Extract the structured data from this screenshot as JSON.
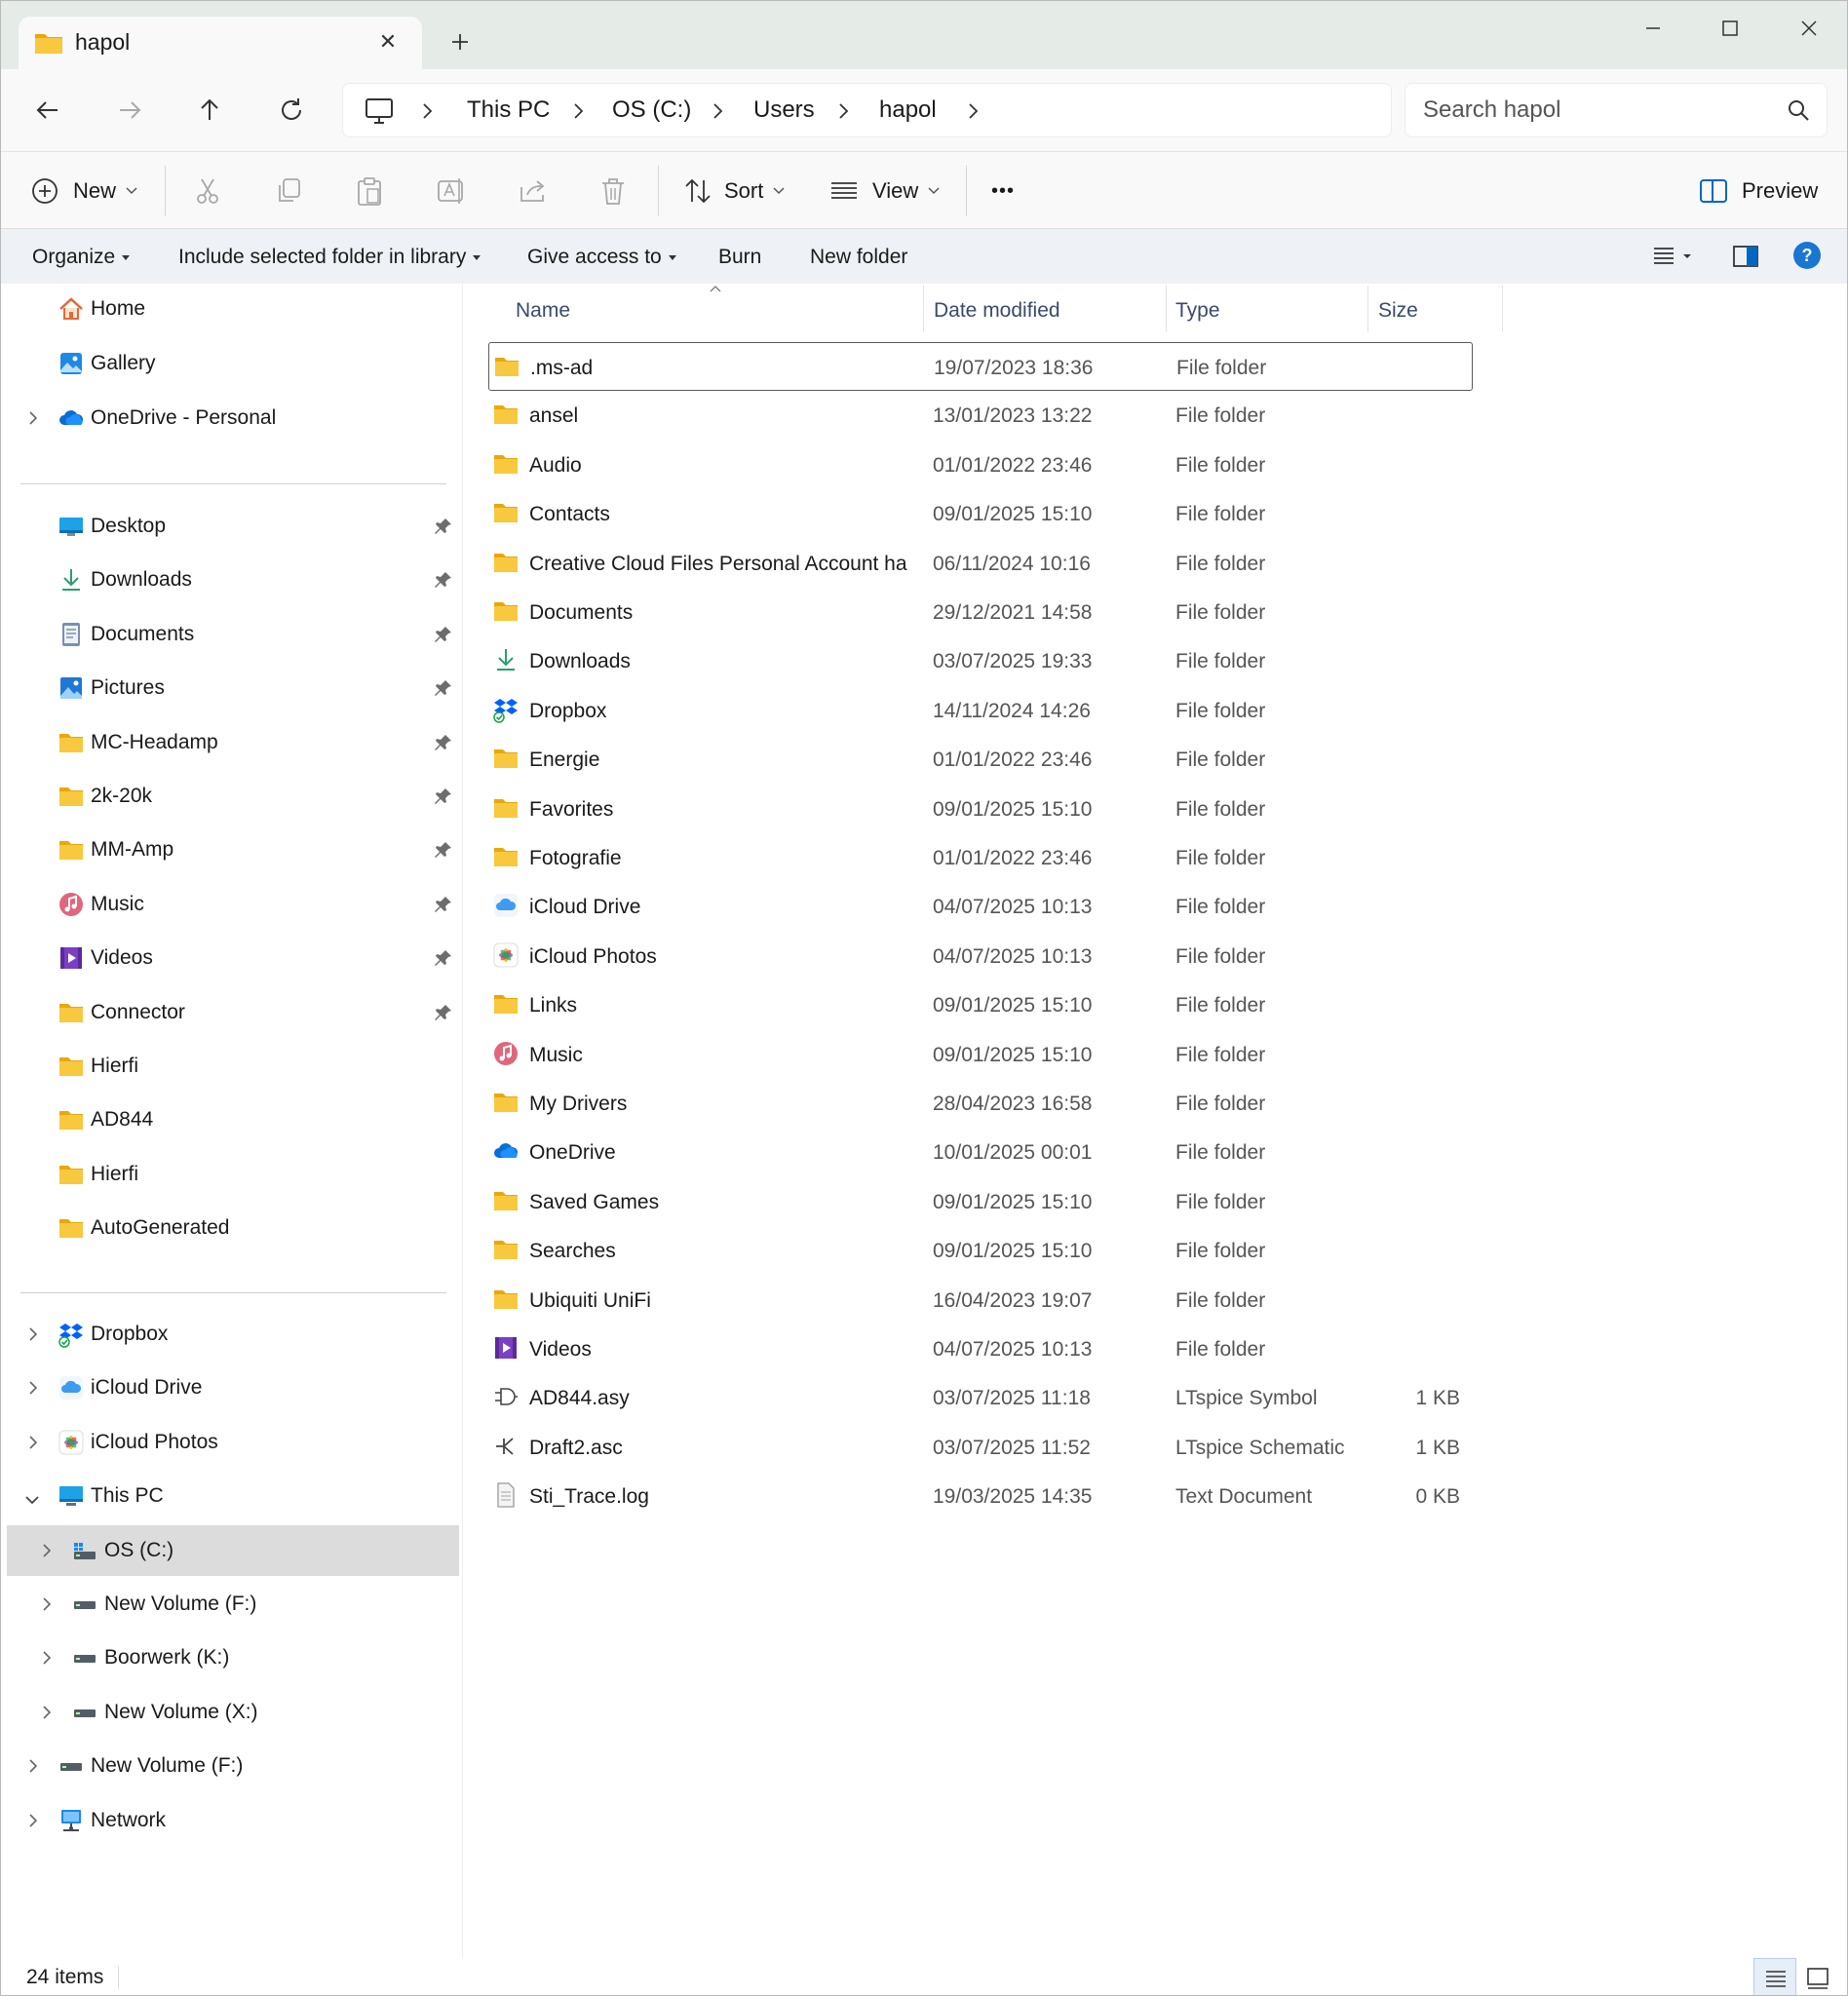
{
  "window": {
    "tab_title": "hapol",
    "tab_icon": "folder-icon"
  },
  "address": {
    "breadcrumbs": [
      "This PC",
      "OS (C:)",
      "Users",
      "hapol"
    ],
    "search_placeholder": "Search hapol"
  },
  "toolbar": {
    "new_label": "New",
    "sort_label": "Sort",
    "view_label": "View",
    "more_label": "•••",
    "preview_label": "Preview"
  },
  "menubar": {
    "organize": "Organize",
    "include": "Include selected folder in library",
    "give_access": "Give access to",
    "burn": "Burn",
    "new_folder": "New folder"
  },
  "nav": {
    "top": [
      {
        "label": "Home",
        "icon": "home-icon"
      },
      {
        "label": "Gallery",
        "icon": "gallery-icon"
      },
      {
        "label": "OneDrive - Personal",
        "icon": "onedrive-icon"
      }
    ],
    "pinned": [
      {
        "label": "Desktop",
        "icon": "desktop-icon"
      },
      {
        "label": "Downloads",
        "icon": "download-icon"
      },
      {
        "label": "Documents",
        "icon": "document-icon"
      },
      {
        "label": "Pictures",
        "icon": "pictures-icon"
      },
      {
        "label": "MC-Headamp",
        "icon": "folder-icon"
      },
      {
        "label": "2k-20k",
        "icon": "folder-icon"
      },
      {
        "label": "MM-Amp",
        "icon": "folder-icon"
      },
      {
        "label": "Music",
        "icon": "music-icon"
      },
      {
        "label": "Videos",
        "icon": "videos-icon"
      },
      {
        "label": "Connector",
        "icon": "folder-icon"
      },
      {
        "label": "Hierfi",
        "icon": "folder-icon"
      },
      {
        "label": "AD844",
        "icon": "folder-icon"
      },
      {
        "label": "Hierfi",
        "icon": "folder-icon"
      },
      {
        "label": "AutoGenerated",
        "icon": "folder-icon"
      }
    ],
    "tree": [
      {
        "label": "Dropbox",
        "icon": "dropbox-icon"
      },
      {
        "label": "iCloud Drive",
        "icon": "icloud-icon"
      },
      {
        "label": "iCloud Photos",
        "icon": "icloud-photos-icon"
      },
      {
        "label": "This PC",
        "icon": "this-pc-icon"
      },
      {
        "label": "OS (C:)",
        "icon": "windows-drive-icon"
      },
      {
        "label": "New Volume (F:)",
        "icon": "drive-icon"
      },
      {
        "label": "Boorwerk (K:)",
        "icon": "drive-icon"
      },
      {
        "label": "New Volume (X:)",
        "icon": "drive-icon"
      },
      {
        "label": "New Volume (F:)",
        "icon": "drive-icon"
      },
      {
        "label": "Network",
        "icon": "network-icon"
      }
    ]
  },
  "columns": {
    "name": "Name",
    "date": "Date modified",
    "type": "Type",
    "size": "Size"
  },
  "files": [
    {
      "name": ".ms-ad",
      "date": "19/07/2023 18:36",
      "type": "File folder",
      "size": "",
      "icon": "folder-icon"
    },
    {
      "name": "ansel",
      "date": "13/01/2023 13:22",
      "type": "File folder",
      "size": "",
      "icon": "folder-icon"
    },
    {
      "name": "Audio",
      "date": "01/01/2022 23:46",
      "type": "File folder",
      "size": "",
      "icon": "folder-icon"
    },
    {
      "name": "Contacts",
      "date": "09/01/2025 15:10",
      "type": "File folder",
      "size": "",
      "icon": "folder-icon"
    },
    {
      "name": "Creative Cloud Files Personal Account ha...",
      "date": "06/11/2024 10:16",
      "type": "File folder",
      "size": "",
      "icon": "folder-icon"
    },
    {
      "name": "Documents",
      "date": "29/12/2021 14:58",
      "type": "File folder",
      "size": "",
      "icon": "folder-icon"
    },
    {
      "name": "Downloads",
      "date": "03/07/2025 19:33",
      "type": "File folder",
      "size": "",
      "icon": "download-icon"
    },
    {
      "name": "Dropbox",
      "date": "14/11/2024 14:26",
      "type": "File folder",
      "size": "",
      "icon": "dropbox-icon"
    },
    {
      "name": "Energie",
      "date": "01/01/2022 23:46",
      "type": "File folder",
      "size": "",
      "icon": "folder-icon"
    },
    {
      "name": "Favorites",
      "date": "09/01/2025 15:10",
      "type": "File folder",
      "size": "",
      "icon": "folder-icon"
    },
    {
      "name": "Fotografie",
      "date": "01/01/2022 23:46",
      "type": "File folder",
      "size": "",
      "icon": "folder-icon"
    },
    {
      "name": "iCloud Drive",
      "date": "04/07/2025 10:13",
      "type": "File folder",
      "size": "",
      "icon": "icloud-icon"
    },
    {
      "name": "iCloud Photos",
      "date": "04/07/2025 10:13",
      "type": "File folder",
      "size": "",
      "icon": "icloud-photos-icon"
    },
    {
      "name": "Links",
      "date": "09/01/2025 15:10",
      "type": "File folder",
      "size": "",
      "icon": "folder-icon"
    },
    {
      "name": "Music",
      "date": "09/01/2025 15:10",
      "type": "File folder",
      "size": "",
      "icon": "music-icon"
    },
    {
      "name": "My Drivers",
      "date": "28/04/2023 16:58",
      "type": "File folder",
      "size": "",
      "icon": "folder-icon"
    },
    {
      "name": "OneDrive",
      "date": "10/01/2025 00:01",
      "type": "File folder",
      "size": "",
      "icon": "onedrive-icon"
    },
    {
      "name": "Saved Games",
      "date": "09/01/2025 15:10",
      "type": "File folder",
      "size": "",
      "icon": "folder-icon"
    },
    {
      "name": "Searches",
      "date": "09/01/2025 15:10",
      "type": "File folder",
      "size": "",
      "icon": "folder-icon"
    },
    {
      "name": "Ubiquiti UniFi",
      "date": "16/04/2023 19:07",
      "type": "File folder",
      "size": "",
      "icon": "folder-icon"
    },
    {
      "name": "Videos",
      "date": "04/07/2025 10:13",
      "type": "File folder",
      "size": "",
      "icon": "videos-icon"
    },
    {
      "name": "AD844.asy",
      "date": "03/07/2025 11:18",
      "type": "LTspice Symbol",
      "size": "1 KB",
      "icon": "ltspice-symbol-icon"
    },
    {
      "name": "Draft2.asc",
      "date": "03/07/2025 11:52",
      "type": "LTspice Schematic",
      "size": "1 KB",
      "icon": "ltspice-schematic-icon"
    },
    {
      "name": "Sti_Trace.log",
      "date": "19/03/2025 14:35",
      "type": "Text Document",
      "size": "0 KB",
      "icon": "text-document-icon"
    }
  ],
  "status": {
    "item_count": "24 items"
  },
  "colors": {
    "folder": "#f8c93e",
    "accent": "#0067c0",
    "titlebar": "#e5ebe6",
    "selection": "#dcdcdc"
  }
}
